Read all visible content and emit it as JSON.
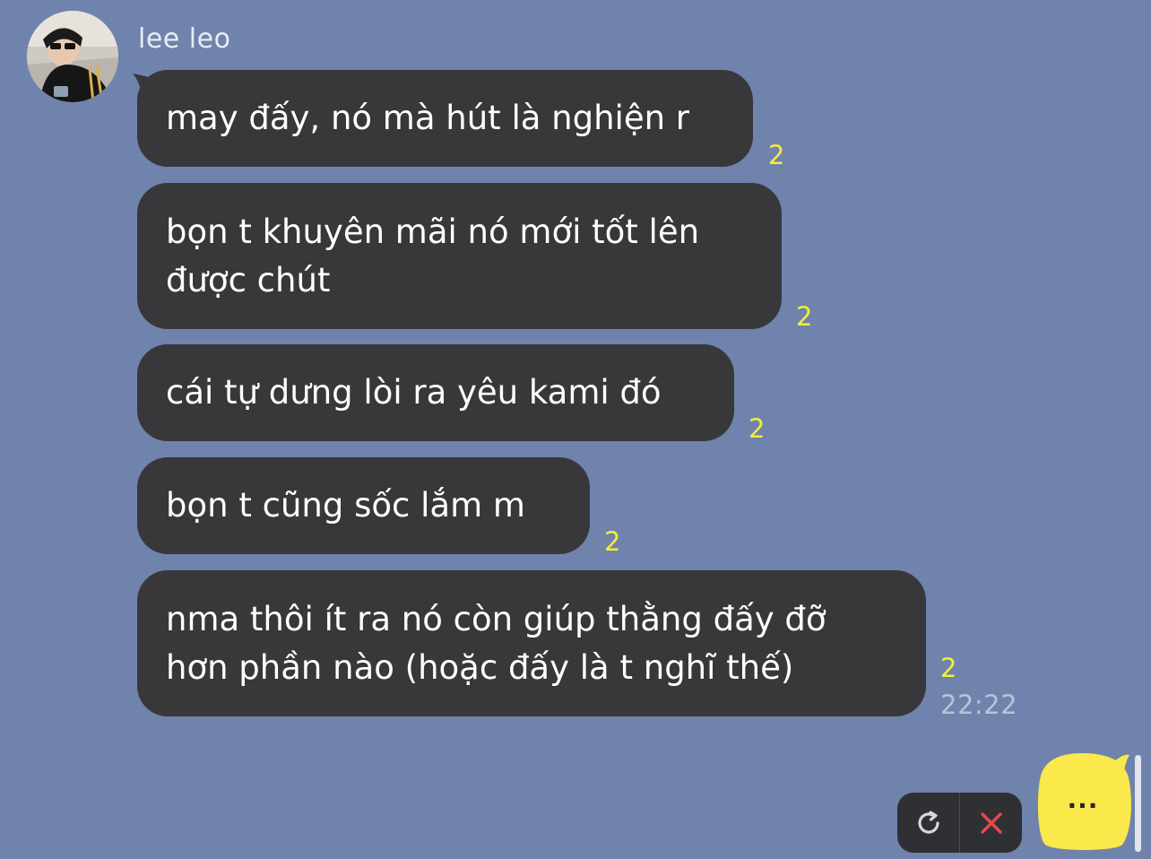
{
  "chat": {
    "sender_name": "lee leo",
    "messages": [
      {
        "text": "may đấy, nó mà hút là nghiện r",
        "read_count": "2"
      },
      {
        "text": "bọn t khuyên mãi nó mới tốt lên\nđược chút",
        "read_count": "2"
      },
      {
        "text": "cái tự dưng lòi ra yêu kami đó",
        "read_count": "2"
      },
      {
        "text": "bọn t cũng sốc lắm m",
        "read_count": "2"
      },
      {
        "text": "nma thôi ít ra nó còn giúp thằng đấy đỡ\nhơn phần nào (hoặc đấy là t nghĩ thế)",
        "read_count": "2",
        "time": "22:22"
      }
    ]
  },
  "composer": {
    "typing_indicator": "···",
    "retry_icon": "refresh-icon",
    "cancel_icon": "close-icon"
  },
  "colors": {
    "background": "#6f83ac",
    "bubble": "#38383b",
    "read_count": "#f5ec3b",
    "typing_bubble": "#fbe84a",
    "cancel": "#e44a4a"
  }
}
